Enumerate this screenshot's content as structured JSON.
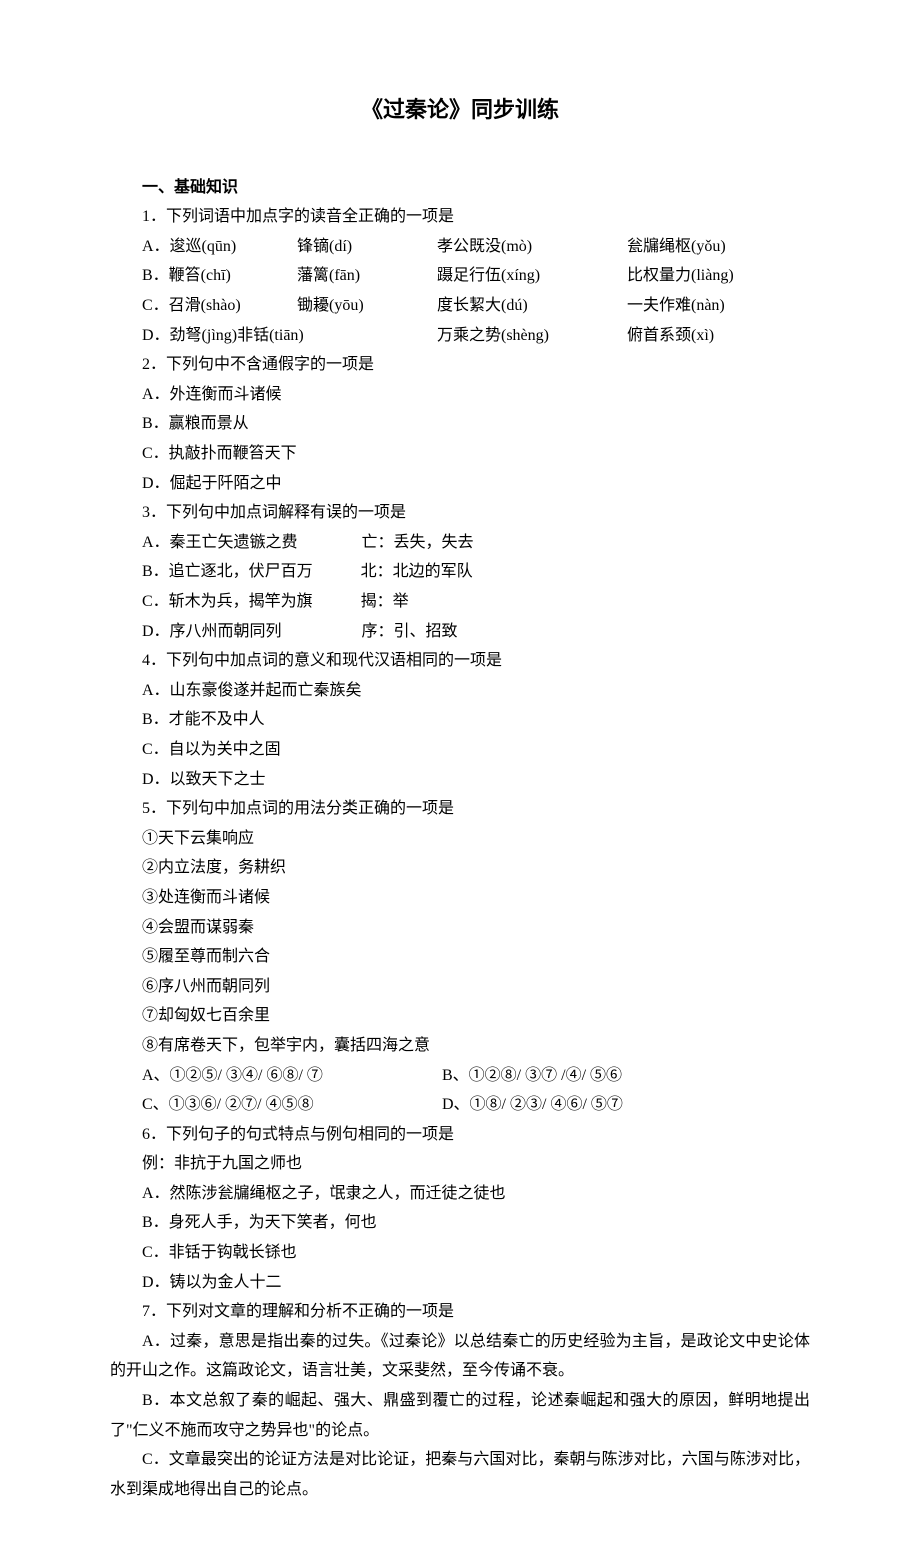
{
  "title": "《过秦论》同步训练",
  "section_head": "一、基础知识",
  "q1": {
    "stem": "1．下列词语中加点字的读音全正确的一项是",
    "rows": [
      [
        "A．逡巡(qūn)",
        "锋镝(dí)",
        "孝公既没(mò)",
        "瓮牖绳枢(yǒu)"
      ],
      [
        "B．鞭笞(chī)",
        "藩篱(fān)",
        "蹑足行伍(xíng)",
        "比权量力(liàng)"
      ],
      [
        "C．召滑(shào)",
        "锄耰(yōu)",
        "度长絜大(dú)",
        "一夫作难(nàn)"
      ],
      [
        "D．劲弩(jìng)非铦(tiān)",
        "",
        "万乘之势(shèng)",
        "俯首系颈(xì)"
      ]
    ]
  },
  "q2": {
    "stem": "2．下列句中不含通假字的一项是",
    "opts": [
      "A．外连衡而斗诸候",
      "B．赢粮而景从",
      "C．执敲扑而鞭笞天下",
      "D．倔起于阡陌之中"
    ]
  },
  "q3": {
    "stem": "3．下列句中加点词解释有误的一项是",
    "opts": [
      "A．秦王亡矢遗镞之费　　　　亡：丢失，失去",
      "B．追亡逐北，伏尸百万　　　北：北边的军队",
      "C．斩木为兵，揭竿为旗　　　揭：举",
      "D．序八州而朝同列　　　　　序：引、招致"
    ]
  },
  "q4": {
    "stem": "4．下列句中加点词的意义和现代汉语相同的一项是",
    "opts": [
      "A．山东豪俊遂并起而亡秦族矣",
      "B．才能不及中人",
      "C．自以为关中之固",
      "D．以致天下之士"
    ]
  },
  "q5": {
    "stem": "5．下列句中加点词的用法分类正确的一项是",
    "items": [
      "①天下云集响应",
      "②内立法度，务耕织",
      "③处连衡而斗诸候",
      "④会盟而谋弱秦",
      "⑤履至尊而制六合",
      "⑥序八州而朝同列",
      "⑦却匈奴七百余里",
      "⑧有席卷天下，包举宇内，囊括四海之意"
    ],
    "choices": [
      [
        "A、①②⑤/ ③④/ ⑥⑧/ ⑦",
        "B、①②⑧/ ③⑦ /④/ ⑤⑥"
      ],
      [
        "C、①③⑥/ ②⑦/ ④⑤⑧",
        "D、①⑧/ ②③/ ④⑥/ ⑤⑦"
      ]
    ]
  },
  "q6": {
    "stem": "6．下列句子的句式特点与例句相同的一项是",
    "example": "例：非抗于九国之师也",
    "opts": [
      "A．然陈涉瓮牖绳枢之子，氓隶之人，而迁徒之徒也",
      "B．身死人手，为天下笑者，何也",
      "C．非铦于钩戟长铩也",
      "D．铸以为金人十二"
    ]
  },
  "q7": {
    "stem": "7．下列对文章的理解和分析不正确的一项是",
    "paras": [
      "A．过秦，意思是指出秦的过失。《过秦论》以总结秦亡的历史经验为主旨，是政论文中史论体的开山之作。这篇政论文，语言壮美，文采斐然，至今传诵不衰。",
      "B．本文总叙了秦的崛起、强大、鼎盛到覆亡的过程，论述秦崛起和强大的原因，鲜明地提出了\"仁义不施而攻守之势异也\"的论点。",
      "C．文章最突出的论证方法是对比论证，把秦与六国对比，秦朝与陈涉对比，六国与陈涉对比，水到渠成地得出自己的论点。"
    ]
  }
}
